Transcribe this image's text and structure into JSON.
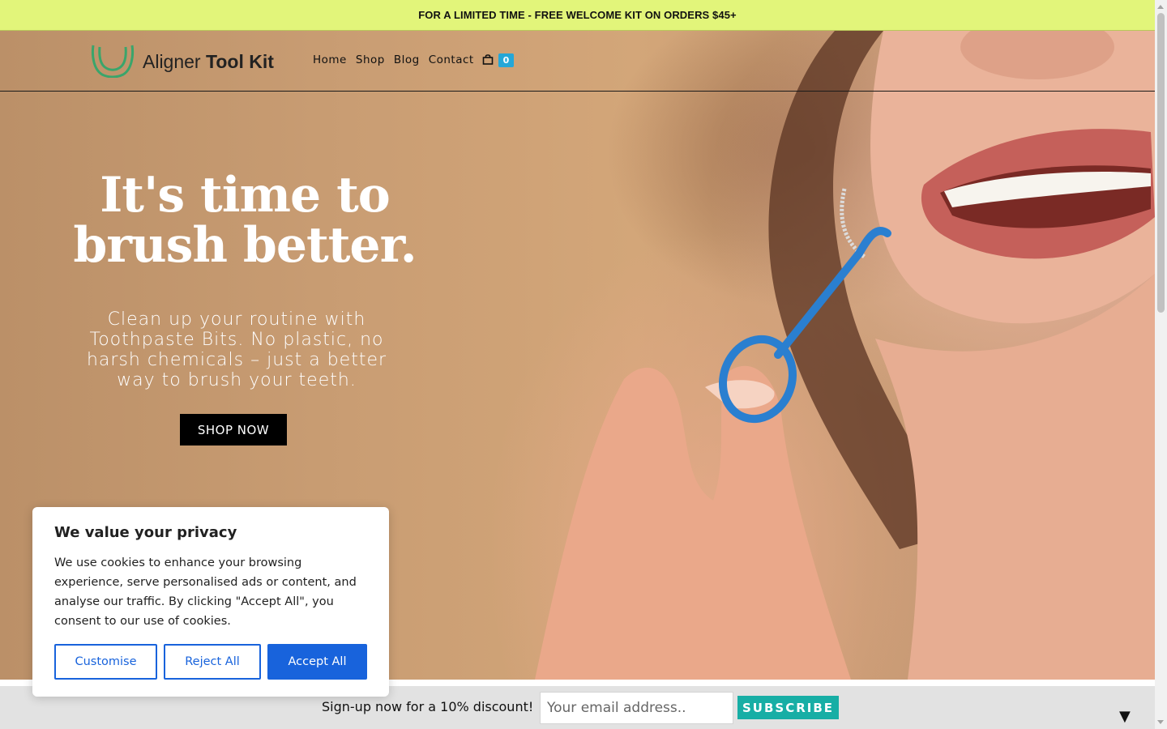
{
  "announcement": "FOR A LIMITED TIME - FREE WELCOME KIT ON ORDERS $45+",
  "header": {
    "logo": {
      "word1": "Aligner",
      "word2": "Tool Kit"
    },
    "menu": [
      "Home",
      "Shop",
      "Blog",
      "Contact"
    ],
    "cart_count": "0"
  },
  "hero": {
    "title_line1": "It's time to",
    "title_line2": "brush better.",
    "subtitle": "Clean up your routine with Toothpaste Bits. No plastic, no harsh chemicals – just a better way to brush your teeth.",
    "cta": "SHOP NOW"
  },
  "cookie": {
    "title": "We value your privacy",
    "body": "We use cookies to enhance your browsing experience, serve personalised ads or content, and analyse our traffic. By clicking \"Accept All\", you consent to our use of cookies.",
    "customise": "Customise",
    "reject": "Reject All",
    "accept": "Accept All"
  },
  "signup": {
    "text": "Sign-up now for a 10% discount!",
    "placeholder": "Your email address..",
    "button": "SUBSCRIBE",
    "collapse": "▼"
  },
  "colors": {
    "announcement_bg": "#e2f57a",
    "cart_badge": "#24a7d8",
    "cookie_blue": "#1863dc",
    "subscribe_teal": "#17aea5"
  },
  "icons": {
    "logo": "aligner-logo-icon",
    "cart": "shopping-bag-icon"
  }
}
